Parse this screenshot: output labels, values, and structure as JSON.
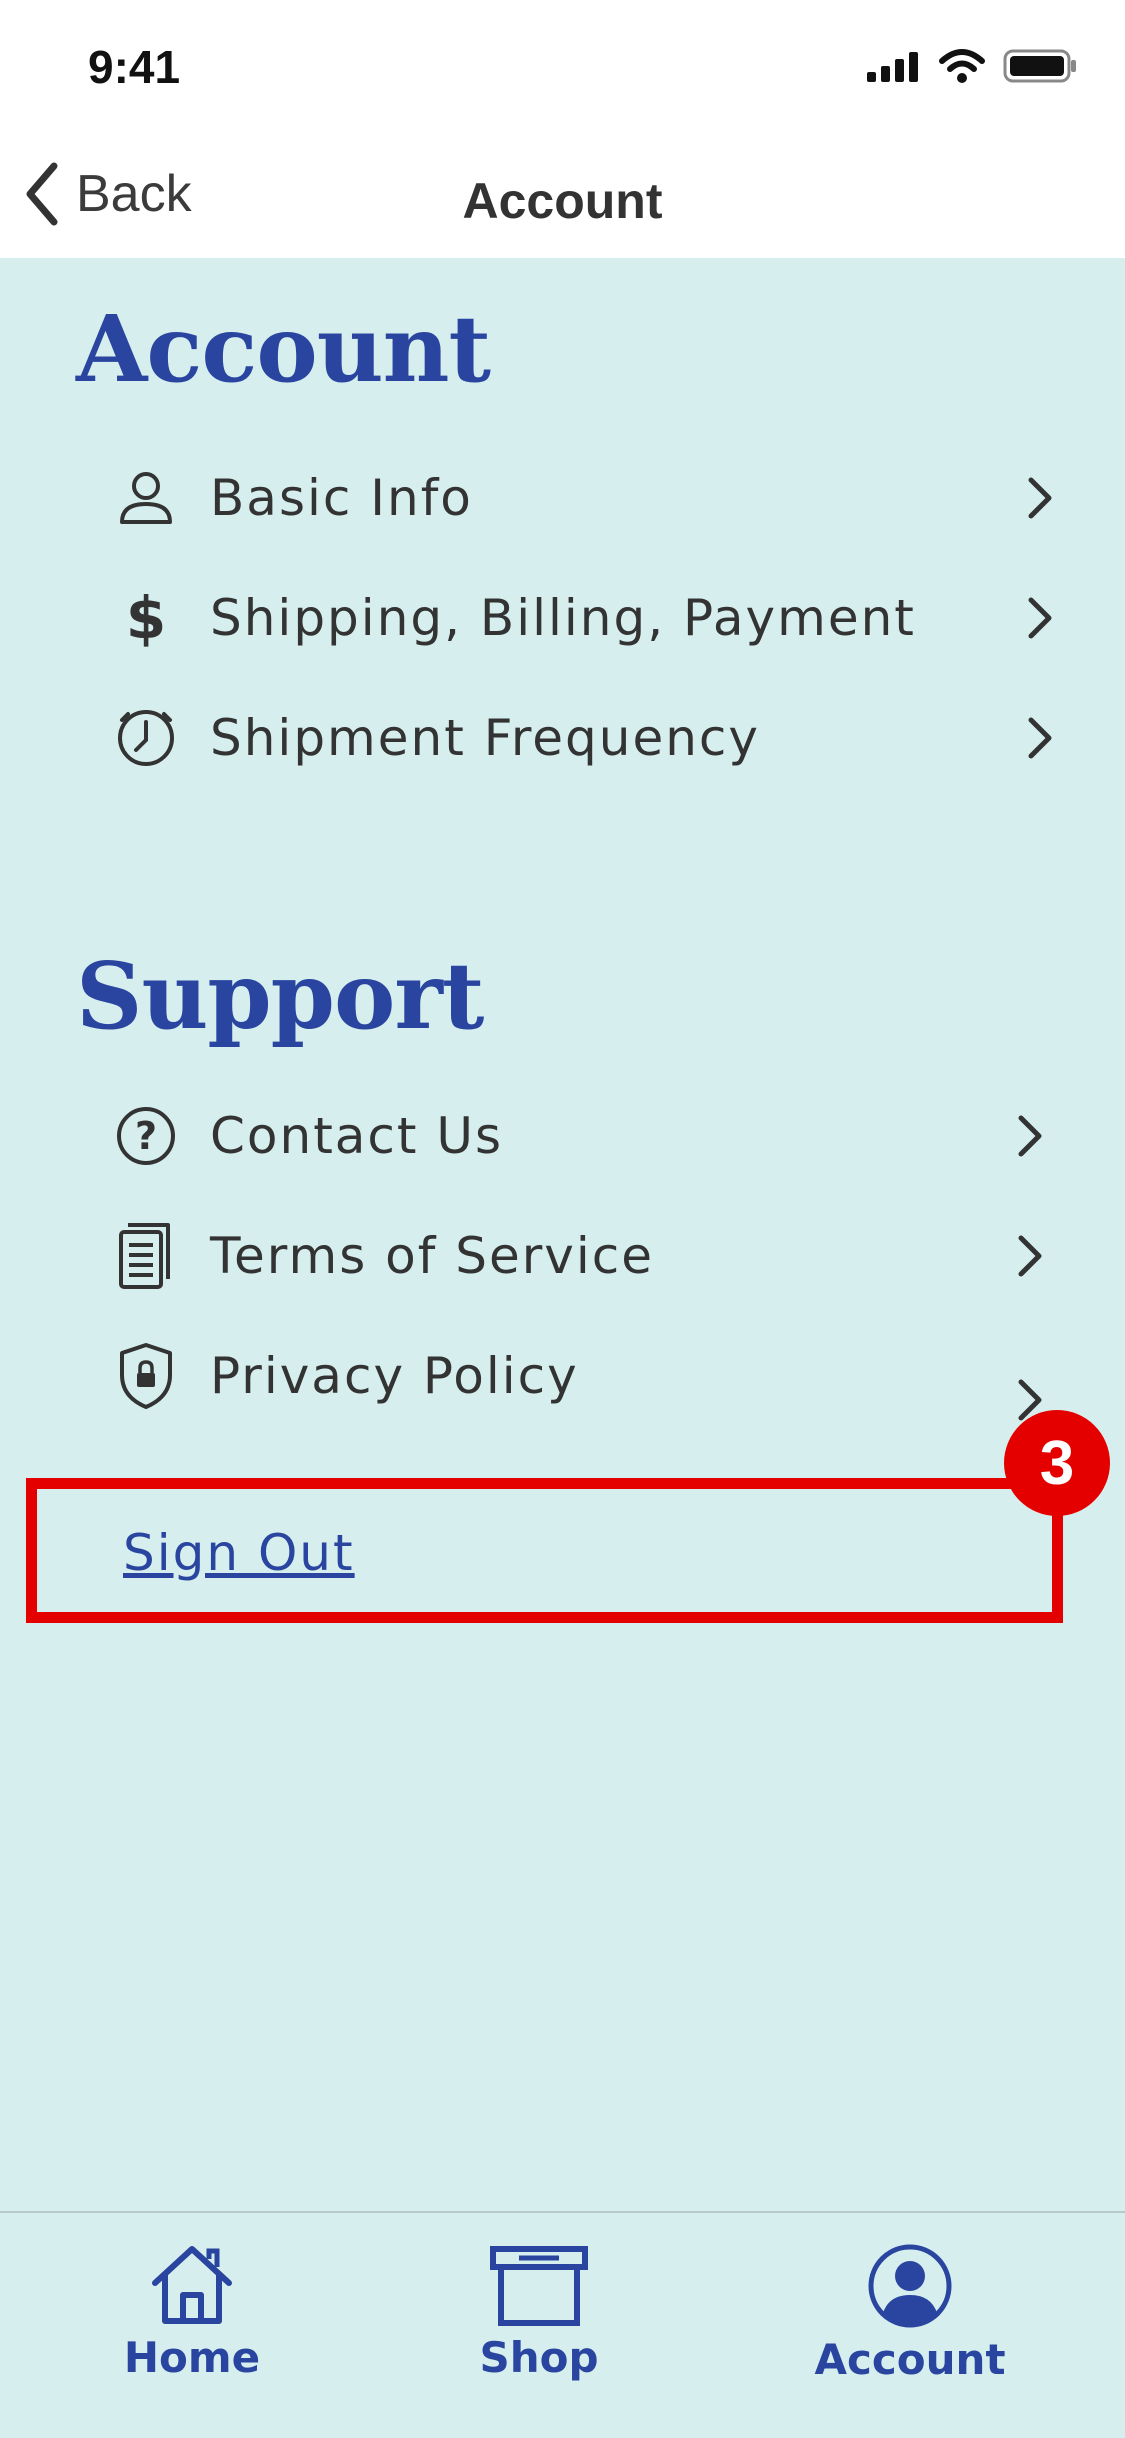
{
  "status_bar": {
    "time": "9:41",
    "icons": [
      "signal-icon",
      "wifi-icon",
      "battery-icon"
    ]
  },
  "nav": {
    "back_label": "Back",
    "title": "Account"
  },
  "account_section": {
    "title": "Account",
    "items": [
      {
        "label": "Basic Info",
        "icon": "person-icon"
      },
      {
        "label": "Shipping, Billing, Payment",
        "icon": "dollar-icon"
      },
      {
        "label": "Shipment Frequency",
        "icon": "clock-icon"
      }
    ]
  },
  "support_section": {
    "title": "Support",
    "items": [
      {
        "label": "Contact Us",
        "icon": "question-icon"
      },
      {
        "label": "Terms of Service",
        "icon": "document-icon"
      },
      {
        "label": "Privacy Policy",
        "icon": "shield-lock-icon"
      }
    ]
  },
  "sign_out": {
    "label": "Sign Out",
    "step_number": "3"
  },
  "tabs": [
    {
      "label": "Home",
      "icon": "home-icon"
    },
    {
      "label": "Shop",
      "icon": "box-icon"
    },
    {
      "label": "Account",
      "icon": "account-icon"
    }
  ],
  "colors": {
    "brand_blue": "#2a45a0",
    "background": "#d6efee",
    "highlight_red": "#e50000"
  }
}
